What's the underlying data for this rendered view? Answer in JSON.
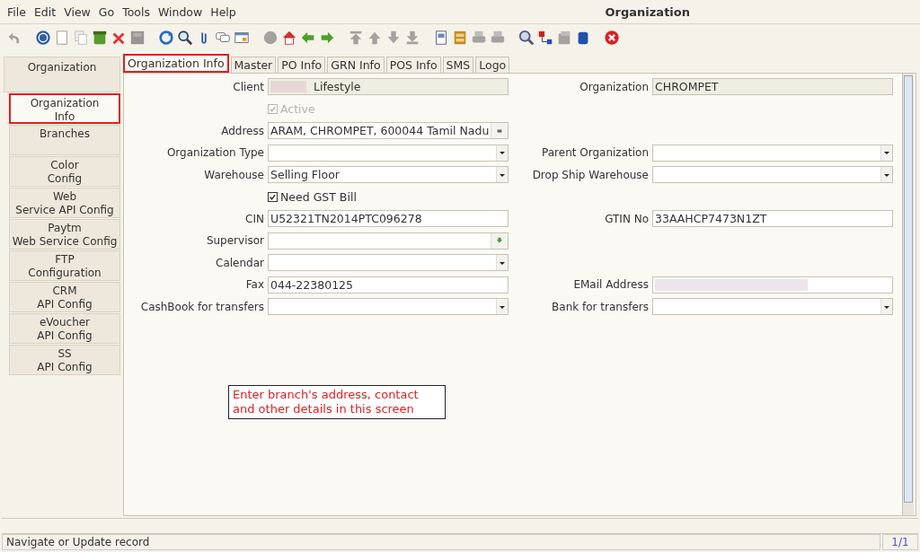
{
  "window": {
    "title": "Organization"
  },
  "menu": [
    "File",
    "Edit",
    "View",
    "Go",
    "Tools",
    "Window",
    "Help"
  ],
  "toolbar": [
    {
      "kind": "undo",
      "disabled": true
    },
    {
      "kind": "gap"
    },
    {
      "kind": "help",
      "disabled": false
    },
    {
      "kind": "new",
      "disabled": false
    },
    {
      "kind": "copy",
      "disabled": true
    },
    {
      "kind": "recycle",
      "disabled": false
    },
    {
      "kind": "delete",
      "disabled": false
    },
    {
      "kind": "save",
      "disabled": true
    },
    {
      "kind": "gap"
    },
    {
      "kind": "refresh",
      "disabled": false
    },
    {
      "kind": "find",
      "disabled": false
    },
    {
      "kind": "attach",
      "disabled": false
    },
    {
      "kind": "chat",
      "disabled": false
    },
    {
      "kind": "grid",
      "disabled": false
    },
    {
      "kind": "gap"
    },
    {
      "kind": "history",
      "disabled": true
    },
    {
      "kind": "home",
      "disabled": false
    },
    {
      "kind": "back",
      "disabled": false
    },
    {
      "kind": "forward",
      "disabled": false
    },
    {
      "kind": "gap"
    },
    {
      "kind": "first",
      "disabled": true
    },
    {
      "kind": "up",
      "disabled": true
    },
    {
      "kind": "down",
      "disabled": true
    },
    {
      "kind": "last",
      "disabled": true
    },
    {
      "kind": "gap"
    },
    {
      "kind": "report",
      "disabled": false
    },
    {
      "kind": "archive",
      "disabled": false
    },
    {
      "kind": "print",
      "disabled": true
    },
    {
      "kind": "print",
      "disabled": true
    },
    {
      "kind": "gap"
    },
    {
      "kind": "zoom",
      "disabled": false
    },
    {
      "kind": "workflow",
      "disabled": false
    },
    {
      "kind": "product",
      "disabled": true
    },
    {
      "kind": "database",
      "disabled": false
    },
    {
      "kind": "gap"
    },
    {
      "kind": "close",
      "disabled": false
    }
  ],
  "sidebar": {
    "header": "Organization",
    "items": [
      {
        "label": "Organization\nInfo",
        "selected": true,
        "highlighted": true
      },
      {
        "label": "Branches",
        "selected": false,
        "highlighted": false
      },
      {
        "label": "Color\nConfig",
        "selected": false,
        "highlighted": false
      },
      {
        "label": "Web\nService API Config",
        "selected": false,
        "highlighted": false
      },
      {
        "label": "Paytm\nWeb Service Config",
        "selected": false,
        "highlighted": false
      },
      {
        "label": "FTP\nConfiguration",
        "selected": false,
        "highlighted": false
      },
      {
        "label": "CRM\nAPI Config",
        "selected": false,
        "highlighted": false
      },
      {
        "label": "eVoucher\nAPI Config",
        "selected": false,
        "highlighted": false
      },
      {
        "label": "SS\nAPI Config",
        "selected": false,
        "highlighted": false
      }
    ]
  },
  "tabs": [
    {
      "label": "Organization Info",
      "selected": true,
      "highlighted": true
    },
    {
      "label": "Master",
      "selected": false,
      "highlighted": false
    },
    {
      "label": "PO Info",
      "selected": false,
      "highlighted": false
    },
    {
      "label": "GRN Info",
      "selected": false,
      "highlighted": false
    },
    {
      "label": "POS Info",
      "selected": false,
      "highlighted": false
    },
    {
      "label": "SMS",
      "selected": false,
      "highlighted": false
    },
    {
      "label": "Logo",
      "selected": false,
      "highlighted": false
    }
  ],
  "rows": [
    {
      "left": {
        "kind": "readonly",
        "label": "Client",
        "value": "Lifestyle",
        "blurred": true
      },
      "right": {
        "kind": "readonly",
        "label": "Organization",
        "value": "CHROMPET"
      }
    },
    {
      "left": {
        "kind": "checkbox",
        "label": "Active",
        "checked": true,
        "disabled": true
      }
    },
    {
      "left": {
        "kind": "location",
        "label": "Address",
        "value": "ARAM, CHROMPET,  600044 Tamil Nadu"
      }
    },
    {
      "left": {
        "kind": "combo",
        "label": "Organization Type"
      },
      "right": {
        "kind": "combo",
        "label": "Parent Organization"
      }
    },
    {
      "left": {
        "kind": "combo",
        "label": "Warehouse",
        "value": "Selling Floor"
      },
      "right": {
        "kind": "combo",
        "label": "Drop Ship Warehouse"
      }
    },
    {
      "left": {
        "kind": "checkbox",
        "label": "Need GST Bill",
        "checked": true,
        "disabled": false
      }
    },
    {
      "left": {
        "kind": "text",
        "label": "CIN",
        "value": "U52321TN2014PTC096278"
      },
      "right": {
        "kind": "text",
        "label": "GTIN No",
        "value": "33AAHCP7473N1ZT"
      }
    },
    {
      "left": {
        "kind": "lookup",
        "label": "Supervisor"
      }
    },
    {
      "left": {
        "kind": "combo",
        "label": "Calendar"
      }
    },
    {
      "left": {
        "kind": "text",
        "label": "Fax",
        "value": "044-22380125"
      },
      "right": {
        "kind": "text",
        "label": "EMail Address",
        "blurred": true
      }
    },
    {
      "left": {
        "kind": "combo",
        "label": "CashBook for transfers"
      },
      "right": {
        "kind": "combo",
        "label": "Bank for transfers"
      }
    }
  ],
  "note": "Enter branch's address, contact and other details in this screen",
  "status_bar": {
    "message": "Navigate or Update record",
    "record": "1/1"
  }
}
